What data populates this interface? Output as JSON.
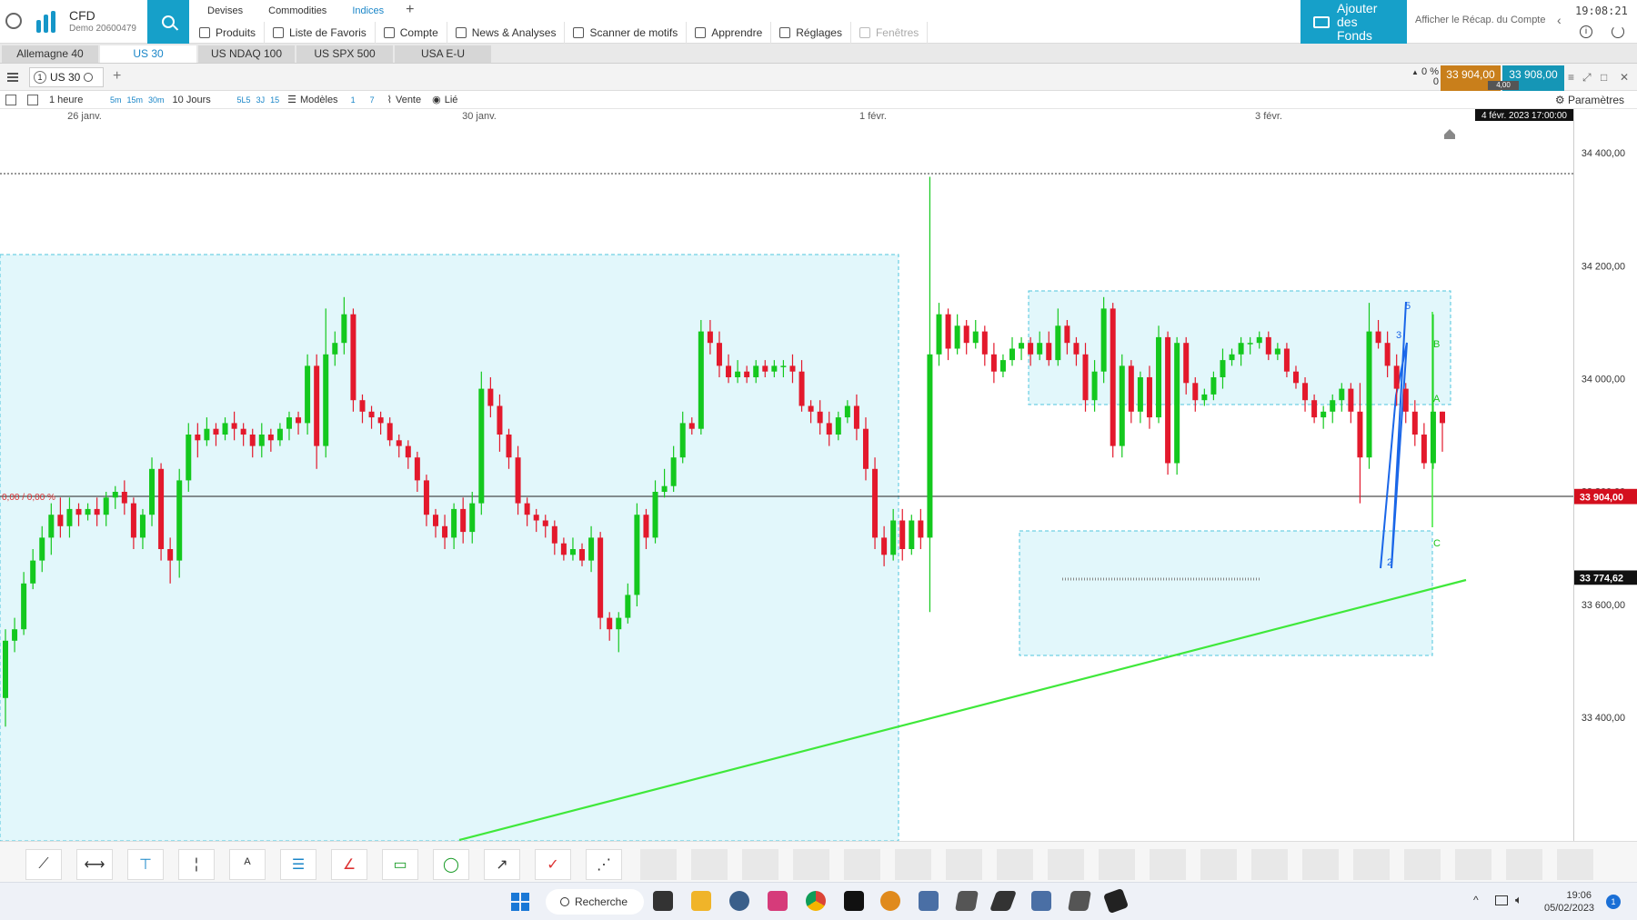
{
  "app": {
    "brand_title": "CFD",
    "brand_subtitle": "Demo 20600479",
    "clock": "19:08:21"
  },
  "header": {
    "category_tabs": [
      "Devises",
      "Commodities",
      "Indices"
    ],
    "active_category": "Indices",
    "menu": [
      {
        "label": "Produits",
        "icon": "document-icon"
      },
      {
        "label": "Liste de Favoris",
        "icon": "list-icon"
      },
      {
        "label": "Compte",
        "icon": "tag-icon"
      },
      {
        "label": "News & Analyses",
        "icon": "news-icon"
      },
      {
        "label": "Scanner de motifs",
        "icon": "pattern-icon"
      },
      {
        "label": "Apprendre",
        "icon": "graduation-icon"
      },
      {
        "label": "Réglages",
        "icon": "gear-icon"
      },
      {
        "label": "Fenêtres",
        "icon": "window-icon",
        "disabled": true
      }
    ],
    "fund_button": "Ajouter des Fonds",
    "recap_link": "Afficher le Récap. du Compte"
  },
  "instrument_tabs": [
    "Allemagne 40",
    "US 30",
    "US NDAQ 100",
    "US SPX 500",
    "USA E-U"
  ],
  "active_instrument": "US 30",
  "chart_toolbar": {
    "symbol": "US 30",
    "symbol_num": "1",
    "change_pct": "0 %",
    "change_abs": "0",
    "bid": "33 904,00",
    "ask": "33 908,00",
    "spread": "4,00"
  },
  "chart_toolbar2": {
    "interval": "1 heure",
    "quick_intervals": [
      "5m",
      "15m",
      "30m"
    ],
    "range": "10 Jours",
    "quick_ranges": [
      "5L5",
      "3J",
      "15"
    ],
    "models": "Modèles",
    "mini": [
      "1",
      "7"
    ],
    "sell": "Vente",
    "linked": "Lié",
    "settings": "Paramètres"
  },
  "chart_data": {
    "type": "candlestick",
    "instrument": "US 30",
    "x_labels": [
      "26 janv.",
      "30 janv.",
      "1 févr.",
      "3 févr."
    ],
    "cursor_time_label": "4 févr. 2023 17:00:00",
    "y_ticks": [
      "34 400,00",
      "34 200,00",
      "34 000,00",
      "33 800,00",
      "33 600,00",
      "33 400,00"
    ],
    "ylim": [
      33380,
      34450
    ],
    "current_price_label": "33 904,00",
    "trendline_value_label": "33 774,62",
    "left_pct_label": "0,00 / 0,00 %",
    "wave_labels": [
      "3",
      "5",
      "2",
      "B",
      "A",
      "C"
    ],
    "candles": [
      [
        33440,
        33540,
        33390,
        33560
      ],
      [
        33540,
        33560,
        33520,
        33580
      ],
      [
        33560,
        33640,
        33550,
        33660
      ],
      [
        33640,
        33680,
        33630,
        33700
      ],
      [
        33680,
        33720,
        33660,
        33740
      ],
      [
        33720,
        33760,
        33690,
        33780
      ],
      [
        33760,
        33740,
        33720,
        33790
      ],
      [
        33740,
        33770,
        33720,
        33790
      ],
      [
        33770,
        33760,
        33740,
        33780
      ],
      [
        33760,
        33770,
        33750,
        33780
      ],
      [
        33770,
        33760,
        33740,
        33790
      ],
      [
        33760,
        33790,
        33740,
        33800
      ],
      [
        33790,
        33800,
        33770,
        33810
      ],
      [
        33800,
        33780,
        33760,
        33820
      ],
      [
        33780,
        33720,
        33700,
        33790
      ],
      [
        33720,
        33760,
        33700,
        33770
      ],
      [
        33760,
        33840,
        33740,
        33860
      ],
      [
        33840,
        33700,
        33680,
        33850
      ],
      [
        33700,
        33680,
        33640,
        33720
      ],
      [
        33680,
        33820,
        33650,
        33840
      ],
      [
        33820,
        33900,
        33800,
        33920
      ],
      [
        33900,
        33890,
        33860,
        33920
      ],
      [
        33890,
        33910,
        33880,
        33930
      ],
      [
        33910,
        33900,
        33880,
        33920
      ],
      [
        33900,
        33920,
        33890,
        33930
      ],
      [
        33920,
        33910,
        33890,
        33940
      ],
      [
        33910,
        33900,
        33880,
        33920
      ],
      [
        33900,
        33880,
        33860,
        33910
      ],
      [
        33880,
        33900,
        33860,
        33920
      ],
      [
        33900,
        33890,
        33870,
        33910
      ],
      [
        33890,
        33910,
        33880,
        33920
      ],
      [
        33910,
        33930,
        33890,
        33940
      ],
      [
        33930,
        33920,
        33900,
        33940
      ],
      [
        33920,
        34020,
        33900,
        34040
      ],
      [
        34020,
        33880,
        33840,
        34040
      ],
      [
        33880,
        34040,
        33860,
        34120
      ],
      [
        34040,
        34060,
        34020,
        34080
      ],
      [
        34060,
        34110,
        34040,
        34140
      ],
      [
        34110,
        33960,
        33940,
        34120
      ],
      [
        33960,
        33940,
        33920,
        33970
      ],
      [
        33940,
        33930,
        33910,
        33950
      ],
      [
        33930,
        33920,
        33900,
        33940
      ],
      [
        33920,
        33890,
        33880,
        33930
      ],
      [
        33890,
        33880,
        33860,
        33900
      ],
      [
        33880,
        33860,
        33840,
        33890
      ],
      [
        33860,
        33820,
        33800,
        33870
      ],
      [
        33820,
        33760,
        33740,
        33830
      ],
      [
        33760,
        33740,
        33720,
        33770
      ],
      [
        33740,
        33720,
        33700,
        33760
      ],
      [
        33720,
        33770,
        33700,
        33780
      ],
      [
        33770,
        33730,
        33710,
        33790
      ],
      [
        33730,
        33780,
        33710,
        33800
      ],
      [
        33780,
        33980,
        33760,
        34010
      ],
      [
        33980,
        33950,
        33930,
        34000
      ],
      [
        33950,
        33900,
        33870,
        33970
      ],
      [
        33900,
        33860,
        33840,
        33910
      ],
      [
        33860,
        33780,
        33760,
        33880
      ],
      [
        33780,
        33760,
        33740,
        33790
      ],
      [
        33760,
        33750,
        33730,
        33770
      ],
      [
        33750,
        33740,
        33720,
        33760
      ],
      [
        33740,
        33710,
        33690,
        33750
      ],
      [
        33710,
        33690,
        33680,
        33720
      ],
      [
        33690,
        33700,
        33680,
        33720
      ],
      [
        33700,
        33680,
        33670,
        33710
      ],
      [
        33680,
        33720,
        33660,
        33740
      ],
      [
        33720,
        33580,
        33560,
        33730
      ],
      [
        33580,
        33560,
        33540,
        33590
      ],
      [
        33560,
        33580,
        33520,
        33590
      ],
      [
        33580,
        33620,
        33570,
        33640
      ],
      [
        33620,
        33760,
        33600,
        33780
      ],
      [
        33760,
        33720,
        33700,
        33770
      ],
      [
        33720,
        33800,
        33710,
        33820
      ],
      [
        33800,
        33810,
        33790,
        33840
      ],
      [
        33810,
        33860,
        33800,
        33880
      ],
      [
        33860,
        33920,
        33850,
        33940
      ],
      [
        33920,
        33910,
        33900,
        33930
      ],
      [
        33910,
        34080,
        33900,
        34100
      ],
      [
        34080,
        34060,
        34040,
        34100
      ],
      [
        34060,
        34020,
        34000,
        34080
      ],
      [
        34020,
        34000,
        33990,
        34040
      ],
      [
        34000,
        34010,
        33990,
        34030
      ],
      [
        34010,
        34000,
        33990,
        34020
      ],
      [
        34000,
        34020,
        33990,
        34030
      ],
      [
        34020,
        34010,
        34000,
        34030
      ],
      [
        34010,
        34020,
        34000,
        34030
      ],
      [
        34020,
        34020,
        34000,
        34030
      ],
      [
        34020,
        34010,
        33990,
        34040
      ],
      [
        34010,
        33950,
        33940,
        34030
      ],
      [
        33950,
        33940,
        33920,
        33960
      ],
      [
        33940,
        33920,
        33900,
        33960
      ],
      [
        33920,
        33900,
        33880,
        33940
      ],
      [
        33900,
        33930,
        33890,
        33940
      ],
      [
        33930,
        33950,
        33920,
        33960
      ],
      [
        33950,
        33910,
        33890,
        33970
      ],
      [
        33910,
        33840,
        33820,
        33930
      ],
      [
        33840,
        33720,
        33700,
        33860
      ],
      [
        33720,
        33690,
        33670,
        33740
      ],
      [
        33690,
        33750,
        33680,
        33770
      ],
      [
        33750,
        33700,
        33680,
        33770
      ],
      [
        33700,
        33750,
        33690,
        33760
      ],
      [
        33750,
        33720,
        33700,
        33770
      ],
      [
        33720,
        34040,
        33590,
        34350
      ],
      [
        34040,
        34110,
        34020,
        34130
      ],
      [
        34110,
        34050,
        34030,
        34120
      ],
      [
        34050,
        34090,
        34040,
        34110
      ],
      [
        34090,
        34060,
        34040,
        34100
      ],
      [
        34060,
        34080,
        34050,
        34100
      ],
      [
        34080,
        34040,
        34020,
        34090
      ],
      [
        34040,
        34010,
        33990,
        34060
      ],
      [
        34010,
        34030,
        34000,
        34040
      ],
      [
        34030,
        34050,
        34020,
        34070
      ],
      [
        34050,
        34060,
        34030,
        34070
      ],
      [
        34060,
        34040,
        34020,
        34070
      ],
      [
        34040,
        34060,
        34030,
        34080
      ],
      [
        34060,
        34030,
        34020,
        34080
      ],
      [
        34030,
        34090,
        34020,
        34120
      ],
      [
        34090,
        34060,
        34040,
        34100
      ],
      [
        34060,
        34040,
        34020,
        34070
      ],
      [
        34040,
        33960,
        33940,
        34060
      ],
      [
        33960,
        34010,
        33940,
        34030
      ],
      [
        34010,
        34120,
        33990,
        34140
      ],
      [
        34120,
        33880,
        33860,
        34130
      ],
      [
        33880,
        34020,
        33860,
        34040
      ],
      [
        34020,
        33940,
        33920,
        34030
      ],
      [
        33940,
        34000,
        33920,
        34010
      ],
      [
        34000,
        33930,
        33910,
        34020
      ],
      [
        33930,
        34070,
        33920,
        34090
      ],
      [
        34070,
        33850,
        33830,
        34080
      ],
      [
        33850,
        34060,
        33830,
        34070
      ],
      [
        34060,
        33990,
        33970,
        34070
      ],
      [
        33990,
        33960,
        33940,
        34000
      ],
      [
        33960,
        33970,
        33950,
        33980
      ],
      [
        33970,
        34000,
        33960,
        34010
      ],
      [
        34000,
        34030,
        33980,
        34050
      ],
      [
        34030,
        34040,
        34020,
        34050
      ],
      [
        34040,
        34060,
        34020,
        34070
      ],
      [
        34060,
        34060,
        34040,
        34070
      ],
      [
        34060,
        34070,
        34050,
        34080
      ],
      [
        34070,
        34040,
        34030,
        34080
      ],
      [
        34040,
        34050,
        34030,
        34060
      ],
      [
        34050,
        34010,
        34000,
        34060
      ],
      [
        34010,
        33990,
        33980,
        34020
      ],
      [
        33990,
        33960,
        33940,
        34000
      ],
      [
        33960,
        33930,
        33920,
        33970
      ],
      [
        33930,
        33940,
        33910,
        33950
      ],
      [
        33940,
        33960,
        33920,
        33970
      ],
      [
        33960,
        33980,
        33940,
        33990
      ],
      [
        33980,
        33940,
        33920,
        33990
      ],
      [
        33940,
        33860,
        33780,
        33990
      ],
      [
        33860,
        34080,
        33840,
        34130
      ],
      [
        34080,
        34060,
        34050,
        34100
      ],
      [
        34060,
        34020,
        34000,
        34080
      ],
      [
        34020,
        33980,
        33950,
        34040
      ],
      [
        33980,
        33940,
        33920,
        33990
      ],
      [
        33940,
        33900,
        33880,
        33960
      ],
      [
        33900,
        33850,
        33840,
        33920
      ],
      [
        33850,
        33940,
        33840,
        34110
      ],
      [
        33940,
        33920,
        33870,
        33940
      ]
    ]
  },
  "drawing_tools": [
    "trendline-tool",
    "horizontal-line-tool",
    "vertical-range-tool",
    "vertical-line-tool",
    "text-tool",
    "fibonacci-tool",
    "gann-tool",
    "rectangle-tool",
    "ellipse-tool",
    "arrow-tool",
    "checkmark-tool",
    "pattern-tool"
  ],
  "taskbar": {
    "search_label": "Recherche",
    "time": "19:06",
    "date": "05/02/2023",
    "notification_count": "1"
  }
}
